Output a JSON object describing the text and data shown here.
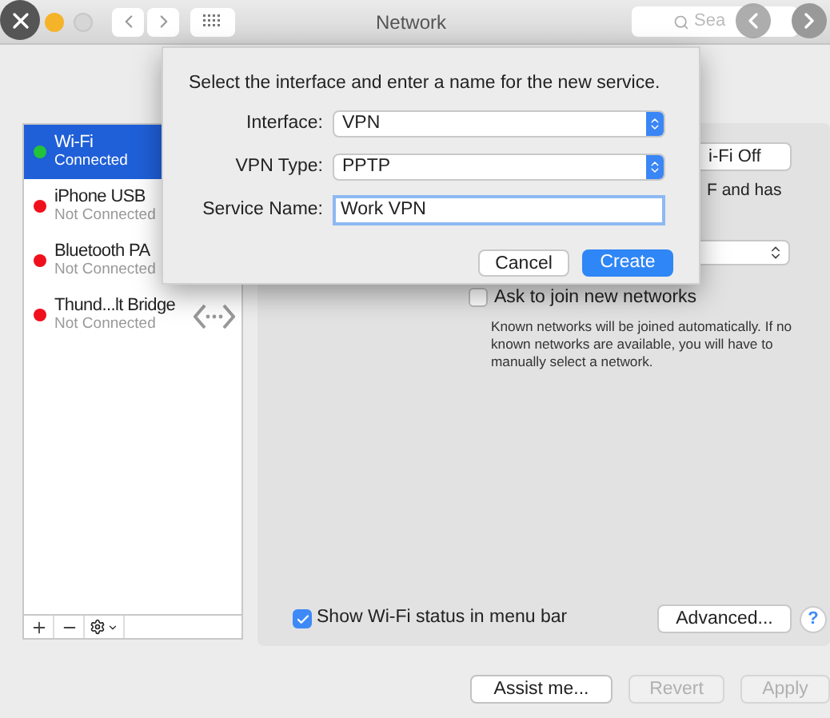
{
  "window": {
    "title": "Network",
    "search": {
      "placeholder": "Sea"
    }
  },
  "services": [
    {
      "name": "Wi-Fi",
      "status": "Connected",
      "color": "#22c33a",
      "selected": true
    },
    {
      "name": "iPhone USB",
      "status": "Not Connected",
      "color": "#f0101c",
      "selected": false
    },
    {
      "name": "Bluetooth PA",
      "status": "Not Connected",
      "color": "#f0101c",
      "selected": false
    },
    {
      "name": "Thund...lt Bridge",
      "status": "Not Connected",
      "color": "#f0101c",
      "selected": false
    }
  ],
  "panel": {
    "wifi_button": "i-Fi Off",
    "wifi_note": "F and has",
    "ask": {
      "label": "Ask to join new networks",
      "checked": false
    },
    "ask_note": "Known networks will be joined automatically. If no known networks are available, you will have to manually select a network.",
    "show_status": {
      "label": "Show Wi-Fi status in menu bar",
      "checked": true
    },
    "advanced": "Advanced...",
    "help": "?"
  },
  "dialog": {
    "prompt": "Select the interface and enter a name for the new service.",
    "fields": [
      {
        "label": "Interface:",
        "kind": "popup",
        "value": "VPN"
      },
      {
        "label": "VPN Type:",
        "kind": "popup",
        "value": "PPTP"
      },
      {
        "label": "Service Name:",
        "kind": "text",
        "value": "Work VPN"
      }
    ],
    "buttons": [
      {
        "label": "Cancel",
        "primary": false
      },
      {
        "label": "Create",
        "primary": true
      }
    ]
  },
  "footer": [
    {
      "label": "Assist me...",
      "disabled": false
    },
    {
      "label": "Revert",
      "disabled": true
    },
    {
      "label": "Apply",
      "disabled": true
    }
  ]
}
